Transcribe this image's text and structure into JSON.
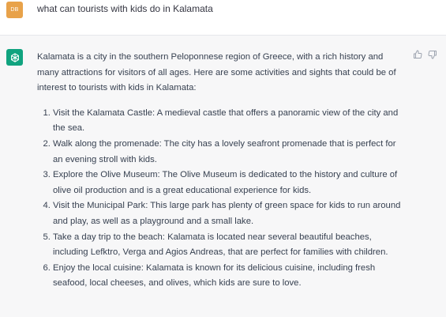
{
  "user": {
    "initials": "DB",
    "message": "what can tourists with kids do in Kalamata"
  },
  "assistant": {
    "intro": "Kalamata is a city in the southern Peloponnese region of Greece, with a rich history and many attractions for visitors of all ages. Here are some activities and sights that could be of interest to tourists with kids in Kalamata:",
    "items": [
      "Visit the Kalamata Castle: A medieval castle that offers a panoramic view of the city and the sea.",
      "Walk along the promenade: The city has a lovely seafront promenade that is perfect for an evening stroll with kids.",
      "Explore the Olive Museum: The Olive Museum is dedicated to the history and culture of olive oil production and is a great educational experience for kids.",
      "Visit the Municipal Park: This large park has plenty of green space for kids to run around and play, as well as a playground and a small lake.",
      "Take a day trip to the beach: Kalamata is located near several beautiful beaches, including Lefktro, Verga and Agios Andreas, that are perfect for families with children.",
      "Enjoy the local cuisine: Kalamata is known for its delicious cuisine, including fresh seafood, local cheeses, and olives, which kids are sure to love."
    ]
  },
  "colors": {
    "user_avatar": "#e8a24a",
    "assistant_avatar": "#10a37f",
    "assistant_bg": "#f7f7f8"
  },
  "icons": {
    "assistant_avatar": "openai-logo-icon",
    "like": "thumbs-up-icon",
    "dislike": "thumbs-down-icon"
  }
}
